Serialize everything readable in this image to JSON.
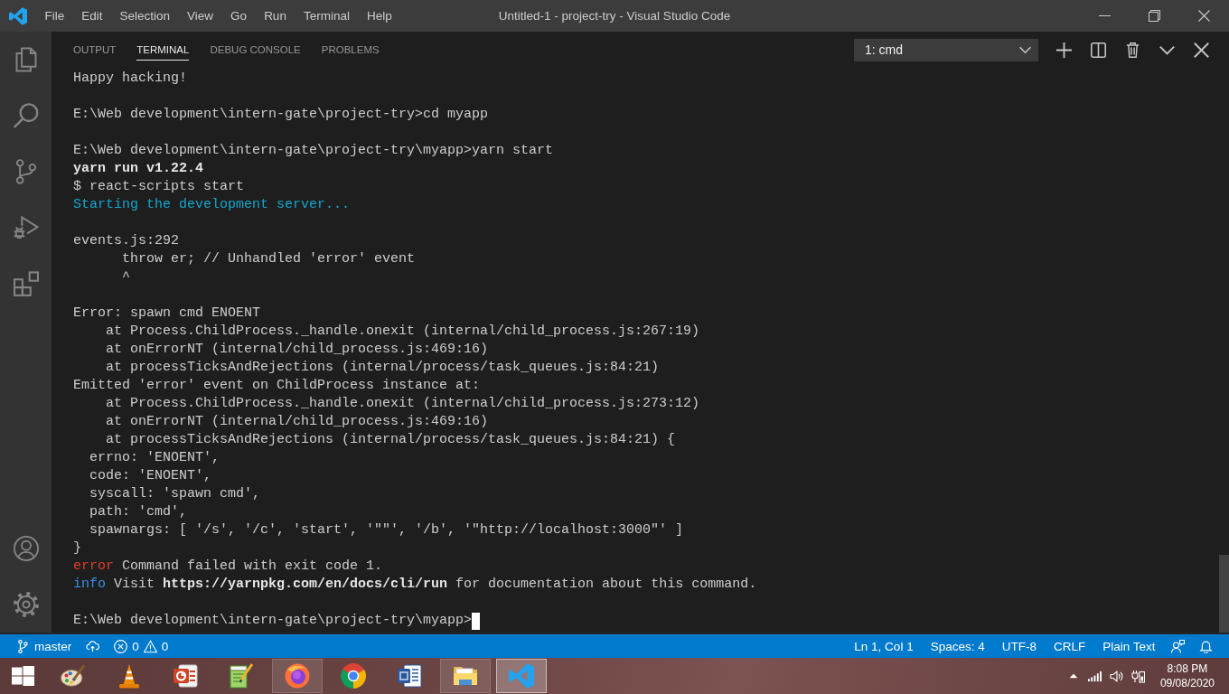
{
  "title_bar": {
    "menu": [
      "File",
      "Edit",
      "Selection",
      "View",
      "Go",
      "Run",
      "Terminal",
      "Help"
    ],
    "title": "Untitled-1 - project-try - Visual Studio Code"
  },
  "panel": {
    "tabs": [
      {
        "label": "OUTPUT",
        "selected": false
      },
      {
        "label": "TERMINAL",
        "selected": true
      },
      {
        "label": "DEBUG CONSOLE",
        "selected": false
      },
      {
        "label": "PROBLEMS",
        "selected": false
      }
    ],
    "terminal_picker": {
      "value": "1: cmd"
    }
  },
  "terminal": {
    "cursor": true,
    "blocks": [
      [
        [
          {
            "kind": "plain",
            "text": "Happy hacking!"
          }
        ]
      ],
      [
        [
          {
            "kind": "plain",
            "text": "E:\\Web development\\intern-gate\\project-try>cd myapp"
          }
        ]
      ],
      [
        [
          {
            "kind": "plain",
            "text": "E:\\Web development\\intern-gate\\project-try\\myapp>yarn start"
          }
        ],
        [
          {
            "kind": "bold",
            "text": "yarn run v1.22.4"
          }
        ],
        [
          {
            "kind": "plain",
            "text": "$ react-scripts start"
          }
        ],
        [
          {
            "kind": "cyan",
            "text": "Starting the development server..."
          }
        ]
      ],
      [
        [
          {
            "kind": "plain",
            "text": "events.js:292"
          }
        ],
        [
          {
            "kind": "plain",
            "text": "      throw er; // Unhandled 'error' event"
          }
        ],
        [
          {
            "kind": "plain",
            "text": "      ^"
          }
        ]
      ],
      [
        [
          {
            "kind": "plain",
            "text": "Error: spawn cmd ENOENT"
          }
        ],
        [
          {
            "kind": "plain",
            "text": "    at Process.ChildProcess._handle.onexit (internal/child_process.js:267:19)"
          }
        ],
        [
          {
            "kind": "plain",
            "text": "    at onErrorNT (internal/child_process.js:469:16)"
          }
        ],
        [
          {
            "kind": "plain",
            "text": "    at processTicksAndRejections (internal/process/task_queues.js:84:21)"
          }
        ],
        [
          {
            "kind": "plain",
            "text": "Emitted 'error' event on ChildProcess instance at:"
          }
        ],
        [
          {
            "kind": "plain",
            "text": "    at Process.ChildProcess._handle.onexit (internal/child_process.js:273:12)"
          }
        ],
        [
          {
            "kind": "plain",
            "text": "    at onErrorNT (internal/child_process.js:469:16)"
          }
        ],
        [
          {
            "kind": "plain",
            "text": "    at processTicksAndRejections (internal/process/task_queues.js:84:21) {"
          }
        ],
        [
          {
            "kind": "plain",
            "text": "  errno: 'ENOENT',"
          }
        ],
        [
          {
            "kind": "plain",
            "text": "  code: 'ENOENT',"
          }
        ],
        [
          {
            "kind": "plain",
            "text": "  syscall: 'spawn cmd',"
          }
        ],
        [
          {
            "kind": "plain",
            "text": "  path: 'cmd',"
          }
        ],
        [
          {
            "kind": "plain",
            "text": "  spawnargs: [ '/s', '/c', 'start', '\"\"', '/b', '\"http://localhost:3000\"' ]"
          }
        ],
        [
          {
            "kind": "plain",
            "text": "}"
          }
        ],
        [
          {
            "kind": "red",
            "text": "error"
          },
          {
            "kind": "plain",
            "text": " Command failed with exit code 1."
          }
        ],
        [
          {
            "kind": "blue",
            "text": "info"
          },
          {
            "kind": "plain",
            "text": " Visit "
          },
          {
            "kind": "bold",
            "text": "https://yarnpkg.com/en/docs/cli/run"
          },
          {
            "kind": "plain",
            "text": " for documentation about this command."
          }
        ]
      ],
      [
        [
          {
            "kind": "plain",
            "text": "E:\\Web development\\intern-gate\\project-try\\myapp>"
          }
        ]
      ]
    ]
  },
  "status_bar": {
    "branch": "master",
    "errors": "0",
    "warnings": "0",
    "items": [
      "Ln 1, Col 1",
      "Spaces: 4",
      "UTF-8",
      "CRLF",
      "Plain Text"
    ]
  },
  "taskbar": {
    "apps": [
      {
        "kind": "paint",
        "open": false,
        "selected": false
      },
      {
        "kind": "cone",
        "open": false,
        "selected": false
      },
      {
        "kind": "slides",
        "open": false,
        "selected": false
      },
      {
        "kind": "notepad",
        "open": false,
        "selected": false
      },
      {
        "kind": "firefox",
        "open": true,
        "selected": false
      },
      {
        "kind": "chrome",
        "open": false,
        "selected": false
      },
      {
        "kind": "word",
        "open": false,
        "selected": false
      },
      {
        "kind": "folder",
        "open": true,
        "selected": false
      },
      {
        "kind": "editor",
        "open": true,
        "selected": true
      }
    ],
    "clock": {
      "time": "8:08 PM",
      "date": "09/08/2020"
    }
  }
}
